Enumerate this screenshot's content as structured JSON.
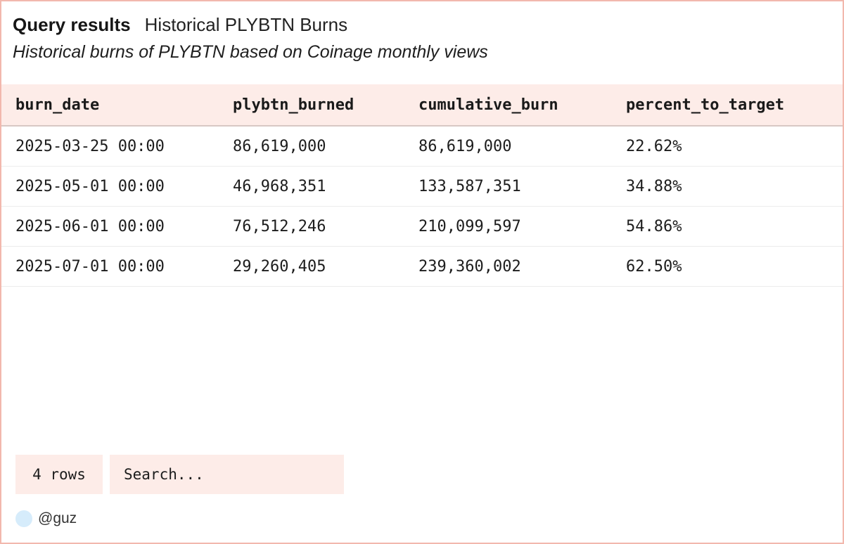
{
  "header": {
    "label": "Query results",
    "title": "Historical PLYBTN Burns",
    "description": "Historical burns of PLYBTN based on Coinage monthly views"
  },
  "table": {
    "columns": [
      "burn_date",
      "plybtn_burned",
      "cumulative_burn",
      "percent_to_target"
    ],
    "rows": [
      [
        "2025-03-25 00:00",
        "86,619,000",
        "86,619,000",
        "22.62%"
      ],
      [
        "2025-05-01 00:00",
        "46,968,351",
        "133,587,351",
        "34.88%"
      ],
      [
        "2025-06-01 00:00",
        "76,512,246",
        "210,099,597",
        "54.86%"
      ],
      [
        "2025-07-01 00:00",
        "29,260,405",
        "239,360,002",
        "62.50%"
      ]
    ]
  },
  "footer": {
    "rows_count": "4 rows",
    "search_placeholder": "Search..."
  },
  "author": {
    "handle": "@guz"
  },
  "colors": {
    "accent_bg": "#fdece8",
    "border": "#f2b8ad",
    "avatar": "#d6ecfb"
  }
}
